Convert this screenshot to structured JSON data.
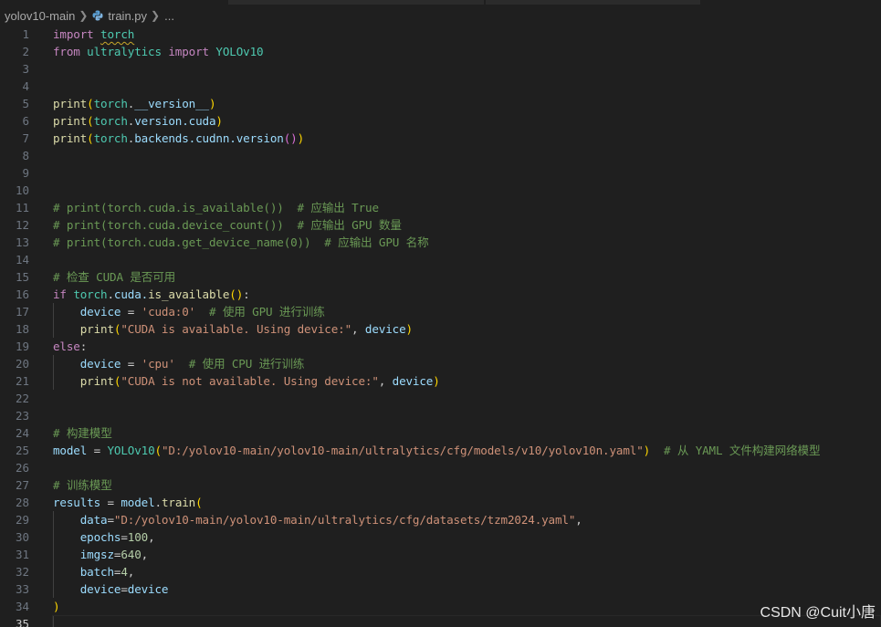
{
  "breadcrumb": {
    "folder": "yolov10-main",
    "file": "train.py",
    "more": "..."
  },
  "colors": {
    "background": "#1f1f1f",
    "keyword": "#c586c0",
    "function": "#dcdcaa",
    "variable": "#9cdcfe",
    "string": "#ce9178",
    "number": "#b5cea8",
    "comment": "#6a9955",
    "class": "#4ec9b0"
  },
  "line_numbers": [
    "1",
    "2",
    "3",
    "4",
    "5",
    "6",
    "7",
    "8",
    "9",
    "10",
    "11",
    "12",
    "13",
    "14",
    "15",
    "16",
    "17",
    "18",
    "19",
    "20",
    "21",
    "22",
    "23",
    "24",
    "25",
    "26",
    "27",
    "28",
    "29",
    "30",
    "31",
    "32",
    "33",
    "34",
    "35"
  ],
  "code": {
    "l1": {
      "kw": "import",
      "mod": "torch"
    },
    "l2": {
      "kw1": "from",
      "mod": "ultralytics",
      "kw2": "import",
      "cls": "YOLOv10"
    },
    "l5": {
      "fn": "print",
      "mod": "torch",
      "attr": "__version__"
    },
    "l6": {
      "fn": "print",
      "mod": "torch",
      "attr": "version.cuda"
    },
    "l7": {
      "fn": "print",
      "mod": "torch",
      "attr": "backends.cudnn.version"
    },
    "l11": "# print(torch.cuda.is_available())  # 应输出 True",
    "l12": "# print(torch.cuda.device_count())  # 应输出 GPU 数量",
    "l13": "# print(torch.cuda.get_device_name(0))  # 应输出 GPU 名称",
    "l15": "# 检查 CUDA 是否可用",
    "l16": {
      "kw": "if",
      "mod": "torch",
      "attr": "cuda.",
      "fn": "is_available"
    },
    "l17": {
      "var": "device",
      "str": "'cuda:0'",
      "cmt": "# 使用 GPU 进行训练"
    },
    "l18": {
      "fn": "print",
      "str": "\"CUDA is available. Using device:\"",
      "var": "device"
    },
    "l19": {
      "kw": "else"
    },
    "l20": {
      "var": "device",
      "str": "'cpu'",
      "cmt": "# 使用 CPU 进行训练"
    },
    "l21": {
      "fn": "print",
      "str": "\"CUDA is not available. Using device:\"",
      "var": "device"
    },
    "l24": "# 构建模型",
    "l25": {
      "var": "model",
      "cls": "YOLOv10",
      "str": "\"D:/yolov10-main/yolov10-main/ultralytics/cfg/models/v10/yolov10n.yaml\"",
      "cmt": "# 从 YAML 文件构建网络模型"
    },
    "l27": "# 训练模型",
    "l28": {
      "var": "results",
      "obj": "model",
      "fn": "train"
    },
    "l29": {
      "var": "data",
      "str": "\"D:/yolov10-main/yolov10-main/ultralytics/cfg/datasets/tzm2024.yaml\""
    },
    "l30": {
      "var": "epochs",
      "num": "100"
    },
    "l31": {
      "var": "imgsz",
      "num": "640"
    },
    "l32": {
      "var": "batch",
      "num": "4"
    },
    "l33": {
      "var": "device",
      "val": "device"
    },
    "l34": ")"
  },
  "watermark": "CSDN @Cuit小唐"
}
